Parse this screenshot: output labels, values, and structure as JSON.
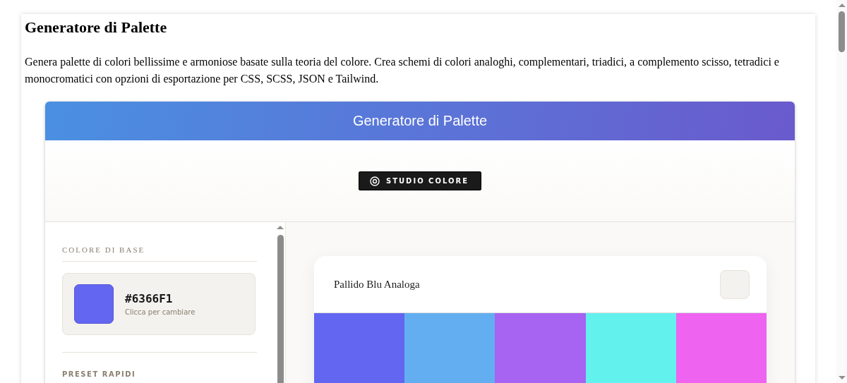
{
  "page": {
    "title": "Generatore di Palette",
    "description": "Genera palette di colori bellissime e armoniose basate sulla teoria del colore. Crea schemi di colori analoghi, complementari, triadici, a complemento scisso, tetradici e monocromatici con opzioni di esportazione per CSS, SCSS, JSON e Tailwind."
  },
  "app": {
    "title": "Generatore di Palette",
    "studio_button": "STUDIO COLORE"
  },
  "sidebar": {
    "base_heading": "COLORE DI BASE",
    "base_color": {
      "hex": "#6366F1",
      "hint": "Clicca per cambiare",
      "color": "#6366f1"
    },
    "presets_heading": "PRESET RAPIDI"
  },
  "palette": {
    "name": "Pallido Blu Analoga",
    "swatches": [
      {
        "color": "#6366f1"
      },
      {
        "color": "#63aef1"
      },
      {
        "color": "#a763f1"
      },
      {
        "color": "#63f1ee"
      },
      {
        "color": "#ef63f1"
      }
    ]
  }
}
